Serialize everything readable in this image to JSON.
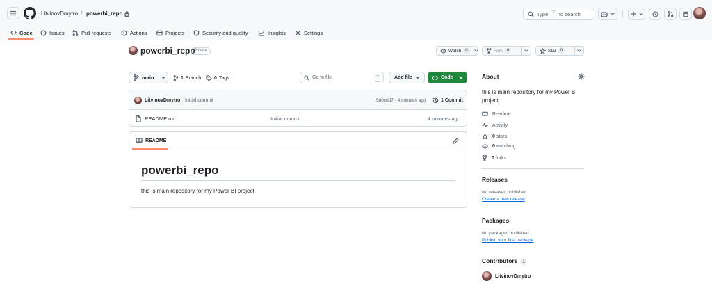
{
  "header": {
    "owner": "LitvinovDmytro",
    "separator": "/",
    "repo": "powerbi_repo",
    "search_placeholder": "Type / to search",
    "search_prefix": "Type",
    "search_key": "/",
    "search_suffix": "to search"
  },
  "tabs": [
    {
      "label": "Code",
      "icon": "code-icon"
    },
    {
      "label": "Issues",
      "icon": "issue-icon"
    },
    {
      "label": "Pull requests",
      "icon": "pull-request-icon"
    },
    {
      "label": "Actions",
      "icon": "play-icon"
    },
    {
      "label": "Projects",
      "icon": "table-icon"
    },
    {
      "label": "Security and quality",
      "icon": "shield-icon"
    },
    {
      "label": "Insights",
      "icon": "graph-icon"
    },
    {
      "label": "Settings",
      "icon": "gear-icon"
    }
  ],
  "repo": {
    "name": "powerbi_repo",
    "visibility": "Private",
    "watch_label": "Watch",
    "watch_count": "0",
    "fork_label": "Fork",
    "fork_count": "0",
    "star_label": "Star",
    "star_count": "0"
  },
  "toolbar": {
    "branch": "main",
    "branch_count": "1",
    "branch_label": "Branch",
    "tag_count": "0",
    "tag_label": "Tags",
    "goto_placeholder": "Go to file",
    "goto_key": "t",
    "add_file": "Add file",
    "code": "Code"
  },
  "commit": {
    "author": "LitvinovDmytro",
    "message": "Initial commit",
    "hash_time": "580cdd7 · 4 minutes ago",
    "count_label": "1 Commit"
  },
  "files": [
    {
      "name": "README.md",
      "message": "Initial commit",
      "time": "4 minutes ago"
    }
  ],
  "readme": {
    "tab_label": "README",
    "heading": "powerbi_repo",
    "body": "this is main repository for my Power BI project"
  },
  "sidebar": {
    "about_title": "About",
    "description": "this is main repository for my Power BI project",
    "items": [
      {
        "label": "Readme",
        "icon": "book-icon"
      },
      {
        "label": "Activity",
        "icon": "pulse-icon"
      },
      {
        "count": "0",
        "label": "stars",
        "icon": "star-icon"
      },
      {
        "count": "0",
        "label": "watching",
        "icon": "eye-icon"
      },
      {
        "count": "0",
        "label": "forks",
        "icon": "fork-icon"
      }
    ],
    "releases_title": "Releases",
    "releases_text": "No releases published",
    "releases_link": "Create a new release",
    "packages_title": "Packages",
    "packages_text": "No packages published",
    "packages_link": "Publish your first package",
    "contributors_title": "Contributors",
    "contributors_count": "1",
    "contributor_name": "LitvinovDmytro"
  },
  "colors": {
    "accent_underline": "#fd8c73",
    "code_button": "#1f883d",
    "link": "#0969da"
  }
}
